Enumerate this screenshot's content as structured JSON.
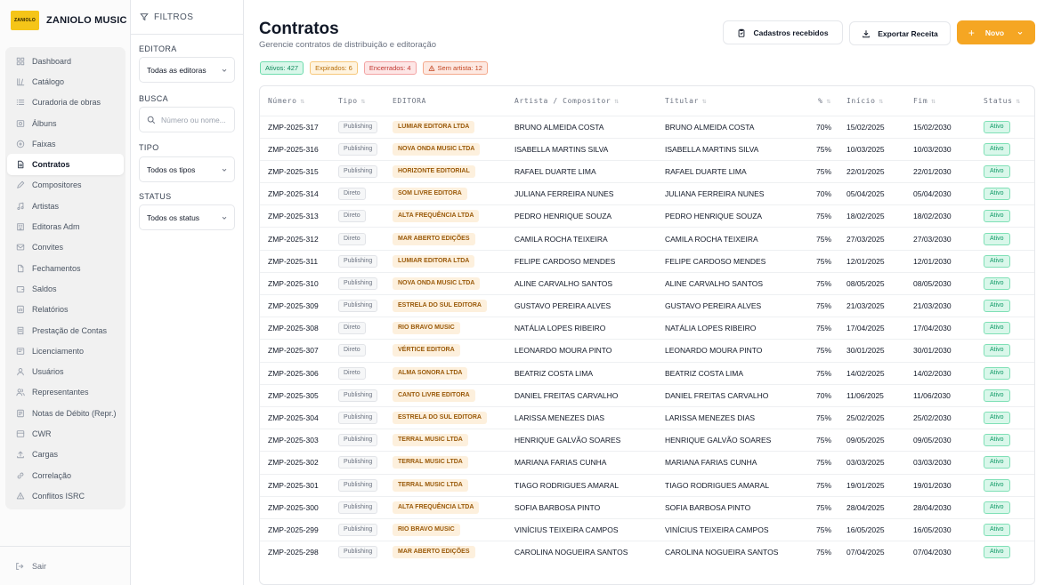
{
  "brand": {
    "name": "ZANIOLO MUSIC",
    "logo_text": "ZANIOLO"
  },
  "sidebar": {
    "items": [
      {
        "label": "Dashboard",
        "icon": "grid-icon"
      },
      {
        "label": "Catálogo",
        "icon": "catalog-icon"
      },
      {
        "label": "Curadoria de obras",
        "icon": "list-icon"
      },
      {
        "label": "Álbuns",
        "icon": "album-icon"
      },
      {
        "label": "Faixas",
        "icon": "disc-icon"
      },
      {
        "label": "Contratos",
        "icon": "document-icon",
        "active": true
      },
      {
        "label": "Compositores",
        "icon": "pen-icon"
      },
      {
        "label": "Artistas",
        "icon": "music-note-icon"
      },
      {
        "label": "Editoras Adm",
        "icon": "building-icon"
      },
      {
        "label": "Convites",
        "icon": "mail-icon"
      },
      {
        "label": "Fechamentos",
        "icon": "file-icon"
      },
      {
        "label": "Saldos",
        "icon": "wallet-icon"
      },
      {
        "label": "Relatórios",
        "icon": "report-icon"
      },
      {
        "label": "Prestação de Contas",
        "icon": "receipt-icon"
      },
      {
        "label": "Licenciamento",
        "icon": "license-icon"
      },
      {
        "label": "Usuários",
        "icon": "user-icon"
      },
      {
        "label": "Representantes",
        "icon": "users-icon"
      },
      {
        "label": "Notas de Débito (Repr.)",
        "icon": "note-icon"
      },
      {
        "label": "CWR",
        "icon": "cwr-icon"
      },
      {
        "label": "Cargas",
        "icon": "upload-icon"
      },
      {
        "label": "Correlação",
        "icon": "link-icon"
      },
      {
        "label": "Conflitos ISRC",
        "icon": "conflict-icon"
      }
    ],
    "logout_label": "Sair"
  },
  "filters": {
    "title": "FILTROS",
    "editora_label": "EDITORA",
    "editora_value": "Todas as editoras",
    "busca_label": "BUSCA",
    "busca_placeholder": "Número ou nome...",
    "tipo_label": "TIPO",
    "tipo_value": "Todos os tipos",
    "status_label": "STATUS",
    "status_value": "Todos os status"
  },
  "header": {
    "title": "Contratos",
    "subtitle": "Gerencie contratos de distribuição e editoração",
    "btn_cadastros": "Cadastros recebidos",
    "btn_exportar": "Exportar Receita",
    "btn_novo": "Novo"
  },
  "badges": [
    {
      "label": "Ativos: 427",
      "bg": "#d9f7ea",
      "border": "#6fdcae",
      "color": "#0f8a5c"
    },
    {
      "label": "Expirados: 6",
      "bg": "#fff4e0",
      "border": "#f6c77a",
      "color": "#b86e08"
    },
    {
      "label": "Encerrados: 4",
      "bg": "#fde6e6",
      "border": "#f3a3a3",
      "color": "#c0352f"
    },
    {
      "label": "Sem artista: 12",
      "bg": "#fde9e2",
      "border": "#f4a98c",
      "color": "#c2441f",
      "icon": "warning-icon"
    }
  ],
  "table": {
    "columns": [
      "Número",
      "Tipo",
      "EDITORA",
      "Artista / Compositor",
      "Titular",
      "%",
      "Início",
      "Fim",
      "Status"
    ],
    "rows": [
      [
        "ZMP-2025-317",
        "Publishing",
        "LUMIAR EDITORA LTDA",
        "BRUNO ALMEIDA COSTA",
        "BRUNO ALMEIDA COSTA",
        "70%",
        "15/02/2025",
        "15/02/2030",
        "Ativo"
      ],
      [
        "ZMP-2025-316",
        "Publishing",
        "NOVA ONDA MUSIC LTDA",
        "ISABELLA MARTINS SILVA",
        "ISABELLA MARTINS SILVA",
        "75%",
        "10/03/2025",
        "10/03/2030",
        "Ativo"
      ],
      [
        "ZMP-2025-315",
        "Publishing",
        "HORIZONTE EDITORIAL",
        "RAFAEL DUARTE LIMA",
        "RAFAEL DUARTE LIMA",
        "75%",
        "22/01/2025",
        "22/01/2030",
        "Ativo"
      ],
      [
        "ZMP-2025-314",
        "Direto",
        "SOM LIVRE EDITORA",
        "JULIANA FERREIRA NUNES",
        "JULIANA FERREIRA NUNES",
        "70%",
        "05/04/2025",
        "05/04/2030",
        "Ativo"
      ],
      [
        "ZMP-2025-313",
        "Direto",
        "ALTA FREQUÊNCIA LTDA",
        "PEDRO HENRIQUE SOUZA",
        "PEDRO HENRIQUE SOUZA",
        "75%",
        "18/02/2025",
        "18/02/2030",
        "Ativo"
      ],
      [
        "ZMP-2025-312",
        "Direto",
        "MAR ABERTO EDIÇÕES",
        "CAMILA ROCHA TEIXEIRA",
        "CAMILA ROCHA TEIXEIRA",
        "75%",
        "27/03/2025",
        "27/03/2030",
        "Ativo"
      ],
      [
        "ZMP-2025-311",
        "Publishing",
        "LUMIAR EDITORA LTDA",
        "FELIPE CARDOSO MENDES",
        "FELIPE CARDOSO MENDES",
        "75%",
        "12/01/2025",
        "12/01/2030",
        "Ativo"
      ],
      [
        "ZMP-2025-310",
        "Publishing",
        "NOVA ONDA MUSIC LTDA",
        "ALINE CARVALHO SANTOS",
        "ALINE CARVALHO SANTOS",
        "75%",
        "08/05/2025",
        "08/05/2030",
        "Ativo"
      ],
      [
        "ZMP-2025-309",
        "Publishing",
        "ESTRELA DO SUL EDITORA",
        "GUSTAVO PEREIRA ALVES",
        "GUSTAVO PEREIRA ALVES",
        "75%",
        "21/03/2025",
        "21/03/2030",
        "Ativo"
      ],
      [
        "ZMP-2025-308",
        "Direto",
        "RIO BRAVO MUSIC",
        "NATÁLIA LOPES RIBEIRO",
        "NATÁLIA LOPES RIBEIRO",
        "75%",
        "17/04/2025",
        "17/04/2030",
        "Ativo"
      ],
      [
        "ZMP-2025-307",
        "Direto",
        "VÉRTICE EDITORA",
        "LEONARDO MOURA PINTO",
        "LEONARDO MOURA PINTO",
        "75%",
        "30/01/2025",
        "30/01/2030",
        "Ativo"
      ],
      [
        "ZMP-2025-306",
        "Direto",
        "ALMA SONORA LTDA",
        "BEATRIZ COSTA LIMA",
        "BEATRIZ COSTA LIMA",
        "75%",
        "14/02/2025",
        "14/02/2030",
        "Ativo"
      ],
      [
        "ZMP-2025-305",
        "Publishing",
        "CANTO LIVRE EDITORA",
        "DANIEL FREITAS CARVALHO",
        "DANIEL FREITAS CARVALHO",
        "70%",
        "11/06/2025",
        "11/06/2030",
        "Ativo"
      ],
      [
        "ZMP-2025-304",
        "Publishing",
        "ESTRELA DO SUL EDITORA",
        "LARISSA MENEZES DIAS",
        "LARISSA MENEZES DIAS",
        "75%",
        "25/02/2025",
        "25/02/2030",
        "Ativo"
      ],
      [
        "ZMP-2025-303",
        "Publishing",
        "TERRAL MUSIC LTDA",
        "HENRIQUE GALVÃO SOARES",
        "HENRIQUE GALVÃO SOARES",
        "75%",
        "09/05/2025",
        "09/05/2030",
        "Ativo"
      ],
      [
        "ZMP-2025-302",
        "Publishing",
        "TERRAL MUSIC LTDA",
        "MARIANA FARIAS CUNHA",
        "MARIANA FARIAS CUNHA",
        "75%",
        "03/03/2025",
        "03/03/2030",
        "Ativo"
      ],
      [
        "ZMP-2025-301",
        "Publishing",
        "TERRAL MUSIC LTDA",
        "TIAGO RODRIGUES AMARAL",
        "TIAGO RODRIGUES AMARAL",
        "75%",
        "19/01/2025",
        "19/01/2030",
        "Ativo"
      ],
      [
        "ZMP-2025-300",
        "Publishing",
        "ALTA FREQUÊNCIA LTDA",
        "SOFIA BARBOSA PINTO",
        "SOFIA BARBOSA PINTO",
        "75%",
        "28/04/2025",
        "28/04/2030",
        "Ativo"
      ],
      [
        "ZMP-2025-299",
        "Publishing",
        "RIO BRAVO MUSIC",
        "VINÍCIUS TEIXEIRA CAMPOS",
        "VINÍCIUS TEIXEIRA CAMPOS",
        "75%",
        "16/05/2025",
        "16/05/2030",
        "Ativo"
      ],
      [
        "ZMP-2025-298",
        "Publishing",
        "MAR ABERTO EDIÇÕES",
        "CAROLINA NOGUEIRA SANTOS",
        "CAROLINA NOGUEIRA SANTOS",
        "75%",
        "07/04/2025",
        "07/04/2030",
        "Ativo"
      ]
    ]
  }
}
